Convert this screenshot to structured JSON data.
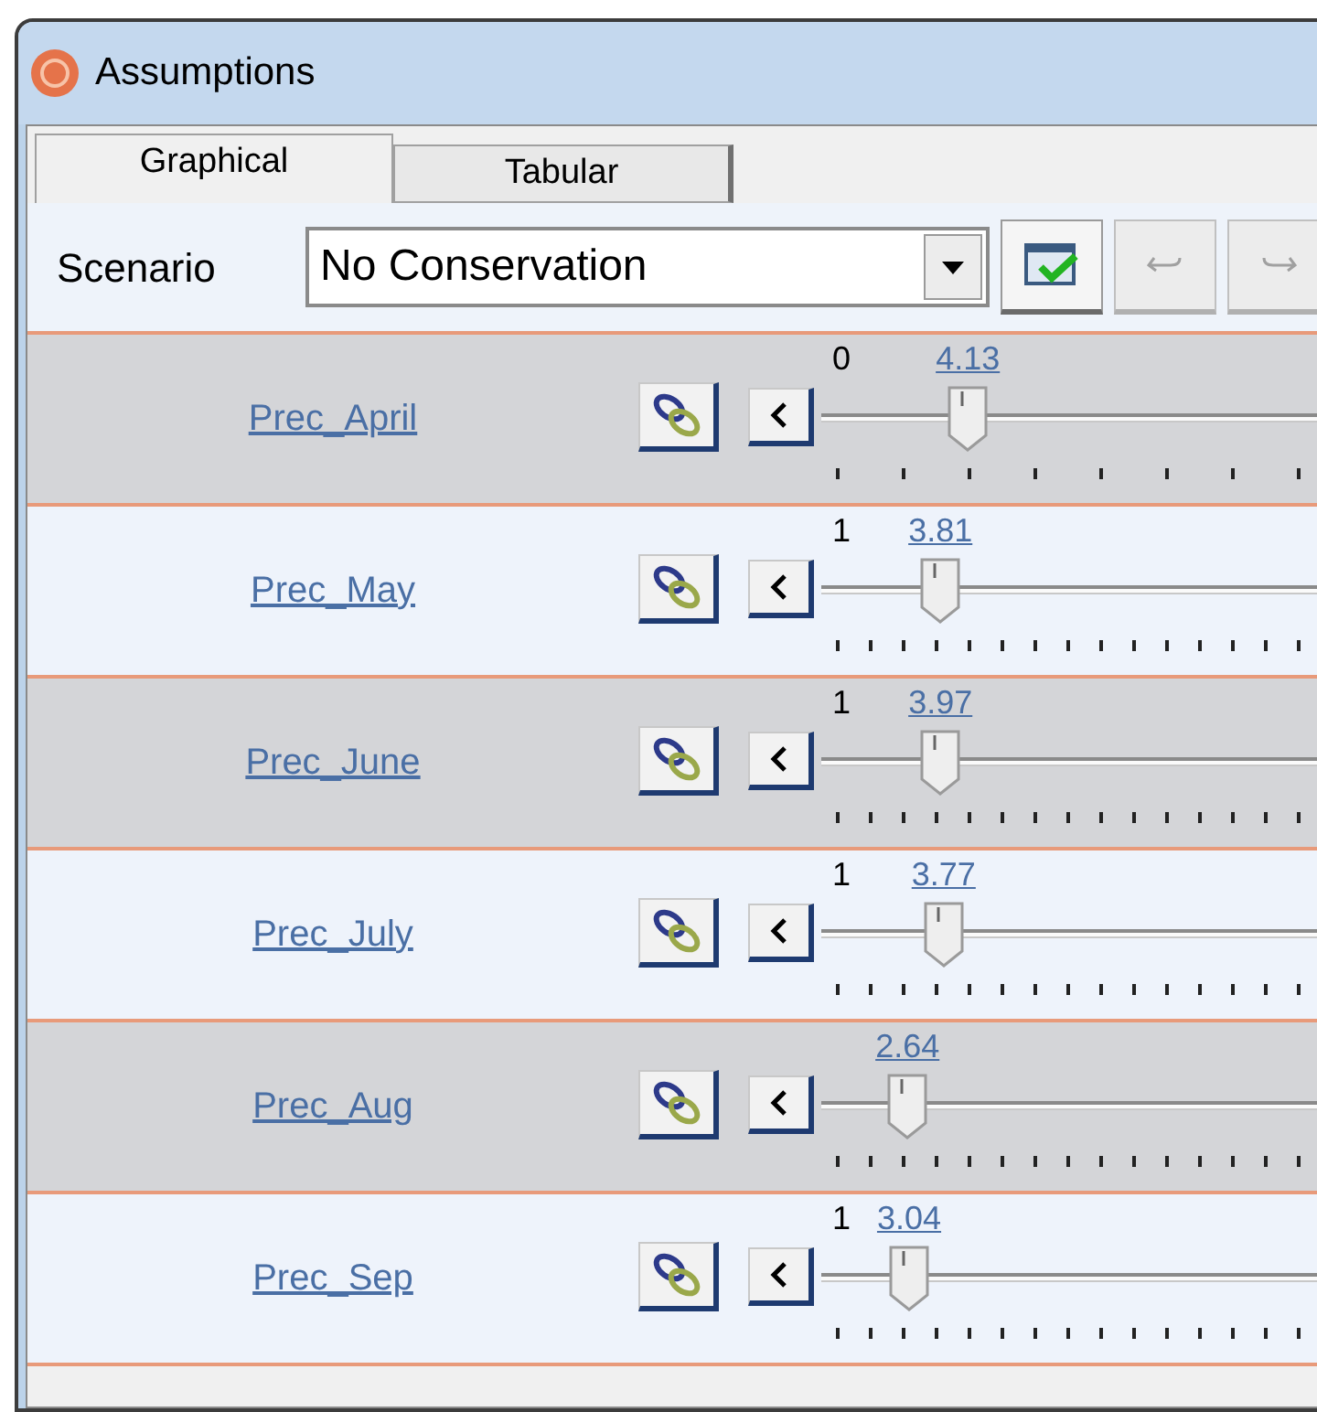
{
  "window": {
    "title": "Assumptions"
  },
  "tabs": [
    {
      "label": "Graphical",
      "selected": true
    },
    {
      "label": "Tabular",
      "selected": false
    }
  ],
  "scenario": {
    "label": "Scenario",
    "value": "No Conservation"
  },
  "toolbar": [
    {
      "kind": "apply",
      "disabled": false
    },
    {
      "kind": "undo",
      "disabled": true
    },
    {
      "kind": "redo",
      "disabled": true
    }
  ],
  "rows": [
    {
      "label": "Prec_April",
      "shaded": true,
      "min": "0",
      "value": "4.13",
      "level": 0.267
    },
    {
      "label": "Prec_May",
      "shaded": false,
      "min": "1",
      "value": "3.81",
      "level": 0.217
    },
    {
      "label": "Prec_June",
      "shaded": true,
      "min": "1",
      "value": "3.97",
      "level": 0.217
    },
    {
      "label": "Prec_July",
      "shaded": false,
      "min": "1",
      "value": "3.77",
      "level": 0.223
    },
    {
      "label": "Prec_Aug",
      "shaded": true,
      "value": "2.64",
      "level": 0.157
    },
    {
      "label": "Prec_Sep",
      "shaded": false,
      "min": "1",
      "value": "3.04",
      "level": 0.16
    }
  ]
}
